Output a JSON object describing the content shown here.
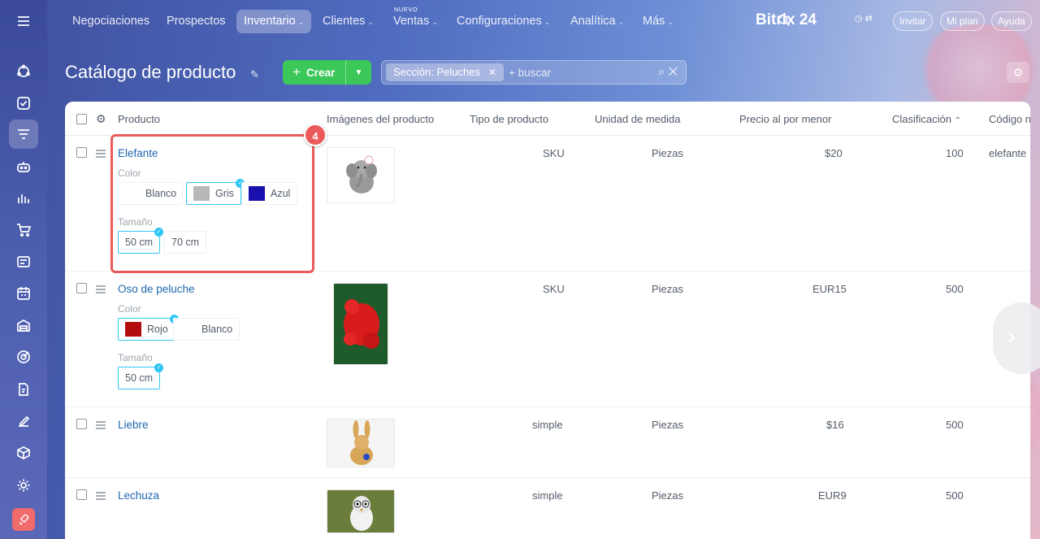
{
  "nav": {
    "items": [
      {
        "label": "Negociaciones"
      },
      {
        "label": "Prospectos"
      },
      {
        "label": "Inventario",
        "active": true,
        "chevron": "⌄"
      },
      {
        "label": "Clientes",
        "chevron": "⌄"
      },
      {
        "label": "Ventas",
        "chevron": "⌄",
        "badge": "NUEVO"
      },
      {
        "label": "Configuraciones",
        "chevron": "⌄"
      },
      {
        "label": "Analítica",
        "chevron": "⌄"
      },
      {
        "label": "Más",
        "chevron": "⌄"
      }
    ],
    "brand": "Bitrix 24",
    "invite": "Invitar",
    "plan": "Mi plan",
    "help": "Ayuda"
  },
  "sidebar": {
    "icons": [
      "menu-icon",
      "crm-icon",
      "tasks-icon",
      "inventory-icon",
      "robot-icon",
      "analytics-icon",
      "cart-icon",
      "contact-center-icon",
      "calendar-icon",
      "warehouse-icon",
      "target-icon",
      "documents-icon",
      "sign-icon",
      "box-icon",
      "settings-icon",
      "rocket-icon"
    ]
  },
  "page": {
    "title": "Catálogo de producto",
    "create_label": "Crear",
    "filter_chip": "Sección: Peluches",
    "search_placeholder": "+ buscar"
  },
  "table": {
    "headers": {
      "product": "Producto",
      "images": "Imágenes del producto",
      "type": "Tipo de producto",
      "unit": "Unidad de medida",
      "price": "Precio al por menor",
      "rank": "Clasificación",
      "code": "Código n"
    },
    "color_label": "Color",
    "size_label": "Tamaño",
    "rows": [
      {
        "name": "Elefante",
        "type": "SKU",
        "unit": "Piezas",
        "price": "$20",
        "rank": "100",
        "code": "elefante",
        "colors": [
          "Blanco",
          "Gris",
          "Azul"
        ],
        "sizes": [
          "50 cm",
          "70 cm"
        ]
      },
      {
        "name": "Oso de peluche",
        "type": "SKU",
        "unit": "Piezas",
        "price": "EUR15",
        "rank": "500",
        "colors": [
          "Rojo",
          "Blanco"
        ],
        "sizes": [
          "50 cm"
        ]
      },
      {
        "name": "Liebre",
        "type": "simple",
        "unit": "Piezas",
        "price": "$16",
        "rank": "500"
      },
      {
        "name": "Lechuza",
        "type": "simple",
        "unit": "Piezas",
        "price": "EUR9",
        "rank": "500"
      }
    ]
  },
  "annotation": {
    "step_badge": "4"
  },
  "colors": {
    "accent": "#2067b0",
    "create_green": "#3bc859",
    "highlight_red": "#ea5a5a",
    "selected_border": "#2fc6f6",
    "swatch_gray": "#b8b8b8",
    "swatch_blue": "#1a10b0",
    "swatch_red": "#b30c0c"
  }
}
